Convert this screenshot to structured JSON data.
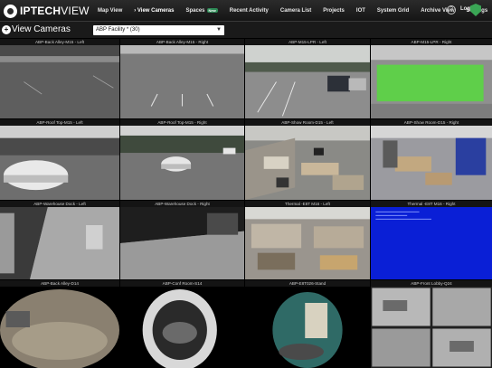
{
  "brand": {
    "name_bold": "IPTECH",
    "name_light": "VIEW"
  },
  "nav": {
    "items": [
      {
        "label": "Map View"
      },
      {
        "label": "› View Cameras"
      },
      {
        "label": "Spaces",
        "badge": "New"
      },
      {
        "label": "Recent Activity"
      },
      {
        "label": "Camera List"
      },
      {
        "label": "Projects"
      },
      {
        "label": "IOT"
      },
      {
        "label": "System Grid"
      },
      {
        "label": "Archive View"
      },
      {
        "label": "Settings"
      }
    ],
    "logout": "Log"
  },
  "page": {
    "title": "View Cameras",
    "facility_select": "ABP Facility * (30)"
  },
  "cameras": [
    {
      "label": "ABP-Back Alley-M15 - Left"
    },
    {
      "label": "ABP-Back Alley-M15 - Right"
    },
    {
      "label": "ABP-M15-LPR - Left"
    },
    {
      "label": "ABP-M15-LPR - Right"
    },
    {
      "label": "ABP-Roof Top-M15 - Left"
    },
    {
      "label": "ABP-Roof Top-M15 - Right"
    },
    {
      "label": "ABP-Show Room-D15 - Left"
    },
    {
      "label": "ABP-Show Room-D15 - Right"
    },
    {
      "label": "ABP-Warehouse Dock - Left"
    },
    {
      "label": "ABP-Warehouse Dock - Right"
    },
    {
      "label": "Thermal -E8T M16 - Left"
    },
    {
      "label": "Thermal -E8T M16 - Right"
    },
    {
      "label": "ABP-Back Alley-D14"
    },
    {
      "label": "ABP-Conf Room-S14"
    },
    {
      "label": "ABP-E8T026-Stand"
    },
    {
      "label": "ABP-Front Lobby-Q24"
    }
  ]
}
